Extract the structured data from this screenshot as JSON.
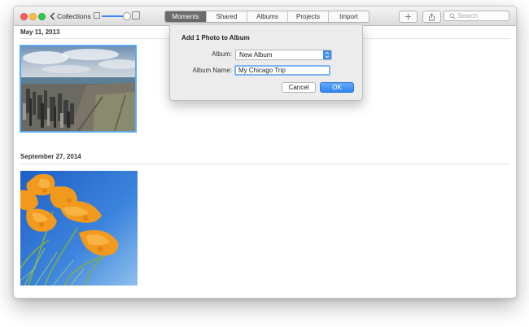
{
  "toolbar": {
    "back_label": "Collections",
    "tabs": [
      {
        "label": "Moments",
        "active": true
      },
      {
        "label": "Shared",
        "active": false
      },
      {
        "label": "Albums",
        "active": false
      },
      {
        "label": "Projects",
        "active": false
      },
      {
        "label": "Import",
        "active": false
      }
    ],
    "add_icon": "plus-icon",
    "share_icon": "share-icon",
    "search_placeholder": "Search"
  },
  "sections": [
    {
      "date": "May 11, 2013",
      "photo": "chicago-skyline-photo"
    },
    {
      "date": "September 27, 2014",
      "photo": "orange-poppies-photo"
    }
  ],
  "dialog": {
    "title": "Add 1 Photo to Album",
    "album_label": "Album:",
    "album_value": "New Album",
    "name_label": "Album Name:",
    "name_value": "My Chicago Trip",
    "cancel_label": "Cancel",
    "ok_label": "OK"
  },
  "colors": {
    "accent": "#3d8ef2",
    "selection": "#5ba9f0",
    "segment_active": "#6b6b6b"
  }
}
